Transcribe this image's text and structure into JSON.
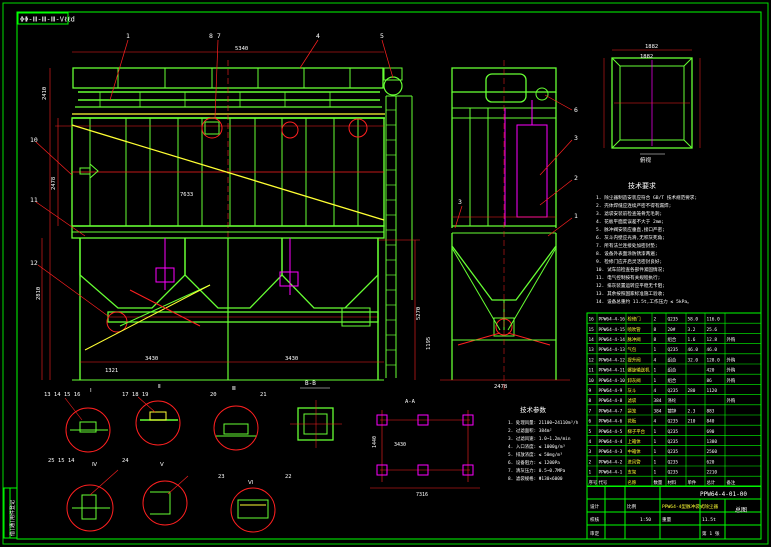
{
  "title_tag": "ΦΦ-Ⅲ-Ⅲ-Ⅲ-Vℓℓd",
  "colors": {
    "background": "#000000",
    "frame": "#00ff00",
    "structure": "#66ff33",
    "accent_red": "#ff2020",
    "magenta": "#ff00ff",
    "yellow": "#ffff33",
    "cyan": "#33ccff",
    "white": "#ffffff"
  },
  "callouts_top": [
    "1",
    "8 7",
    "4",
    "5"
  ],
  "callouts_left": [
    "10",
    "11",
    "12"
  ],
  "callouts_side": [
    "6",
    "3",
    "2",
    "1",
    "3"
  ],
  "dims": {
    "front_width": "7633",
    "left_span": "3430",
    "right_span": "3430",
    "bottom_left": "1321",
    "top_height": "2410",
    "side_width": "2478",
    "mid_height_a": "2478",
    "mid_height_b": "2810",
    "plan_w": "5340",
    "plan_top": "1882",
    "plan_inner": "1882",
    "small_top": "9",
    "anchor_a": "3430",
    "anchor_b": "7316",
    "anchor_c": "1440",
    "height_total": "1195",
    "leg_height": "5270"
  },
  "section_label_a": "B-B",
  "section_label_b": "A-A",
  "plan_label": "俯视",
  "tech_title": "技术要求",
  "tech_lines": [
    "1. 除尘器制造安装应符合 GB/T 技术规范要求;",
    "2. 壳体焊缝应连续严密不得有漏焊;",
    "3. 滤袋安装前检查笼骨无毛刺;",
    "4. 花板平面度误差不大于 2mm;",
    "5. 脉冲阀安装应垂直,接口严密;",
    "6. 灰斗内壁应光滑,无积灰死角;",
    "7. 所有法兰连接处加密封垫;",
    "8. 设备外表面涂防锈漆两遍;",
    "9. 检修门应开启灵活密封良好;",
    "10. 试车前检查各部件紧固情况;",
    "11. 电气控制按有关规程执行;",
    "12. 排灰装置运转应平稳无卡阻;",
    "13. 其余按照国家标准施工验收;",
    "14. 设备总重约 11.5t,工作压力 ≤ 5kPa。"
  ],
  "params_title": "技术参数",
  "params_lines": [
    "1. 处理风量: 21100~24110m³/h",
    "2. 过滤面积: 384m²",
    "3. 过滤风速: 1.0~1.2m/min",
    "4. 入口浓度: ≤ 1000g/m³",
    "5. 排放浓度: ≤ 50mg/m³",
    "6. 设备阻力: ≤ 1200Pa",
    "7. 清灰压力: 0.5~0.7MPa",
    "8. 滤袋规格: Φ130×6000"
  ],
  "detail_labels": [
    "Ⅰ",
    "Ⅱ",
    "Ⅲ",
    "Ⅳ",
    "Ⅴ",
    "Ⅵ",
    "Ⅶ",
    "Ⅷ"
  ],
  "detail_refs_top": [
    "13 14 15 16",
    "17 18 19",
    "20",
    "21"
  ],
  "detail_refs_bottom": [
    "25 15 14",
    "24",
    "23",
    "22"
  ],
  "parts_rows": [
    [
      "16",
      "PPW64-4-16",
      "检修门",
      "2",
      "Q235",
      "58.0",
      "116.0",
      ""
    ],
    [
      "15",
      "PPW64-4-15",
      "喷吹管",
      "8",
      "20#",
      "3.2",
      "25.6",
      ""
    ],
    [
      "14",
      "PPW64-4-14",
      "脉冲阀",
      "8",
      "组合",
      "1.6",
      "12.8",
      "外购"
    ],
    [
      "13",
      "PPW64-4-13",
      "气包",
      "1",
      "Q235",
      "46.0",
      "46.0",
      ""
    ],
    [
      "12",
      "PPW64-4-12",
      "提升阀",
      "4",
      "组合",
      "32.0",
      "128.0",
      "外购"
    ],
    [
      "11",
      "PPW64-4-11",
      "螺旋输送机",
      "1",
      "组合",
      "",
      "420",
      "外购"
    ],
    [
      "10",
      "PPW64-4-10",
      "卸灰阀",
      "1",
      "组合",
      "",
      "86",
      "外购"
    ],
    [
      "9",
      "PPW64-4-9",
      "灰斗",
      "4",
      "Q235",
      "280",
      "1120",
      ""
    ],
    [
      "8",
      "PPW64-4-8",
      "滤袋",
      "384",
      "涤纶",
      "",
      "",
      "外购"
    ],
    [
      "7",
      "PPW64-4-7",
      "袋笼",
      "384",
      "镀锌",
      "2.3",
      "883",
      ""
    ],
    [
      "6",
      "PPW64-4-6",
      "花板",
      "4",
      "Q235",
      "210",
      "840",
      ""
    ],
    [
      "5",
      "PPW64-4-5",
      "梯子平台",
      "1",
      "Q235",
      "",
      "690",
      ""
    ],
    [
      "4",
      "PPW64-4-4",
      "上箱体",
      "1",
      "Q235",
      "",
      "1380",
      ""
    ],
    [
      "3",
      "PPW64-4-3",
      "中箱体",
      "1",
      "Q235",
      "",
      "2560",
      ""
    ],
    [
      "2",
      "PPW64-4-2",
      "进风管",
      "1",
      "Q235",
      "",
      "620",
      ""
    ],
    [
      "1",
      "PPW64-4-1",
      "支架",
      "1",
      "Q235",
      "",
      "2210",
      ""
    ],
    [
      "序号",
      "代号",
      "名称",
      "数量",
      "材料",
      "单件",
      "总计",
      "备注"
    ]
  ],
  "title_block": {
    "drawing_no": "PPW64-4-01-00",
    "name": "PPW64-4型脉冲袋式除尘器",
    "sheet_label": "总图",
    "scale_label": "比例",
    "scale": "1:50",
    "weight_label": "重量",
    "weight": "11.5t",
    "sheet_no": "第 1 张",
    "designer": "设计",
    "checker": "校核",
    "approver": "审定"
  },
  "left_strip": "借(通)用件登记"
}
